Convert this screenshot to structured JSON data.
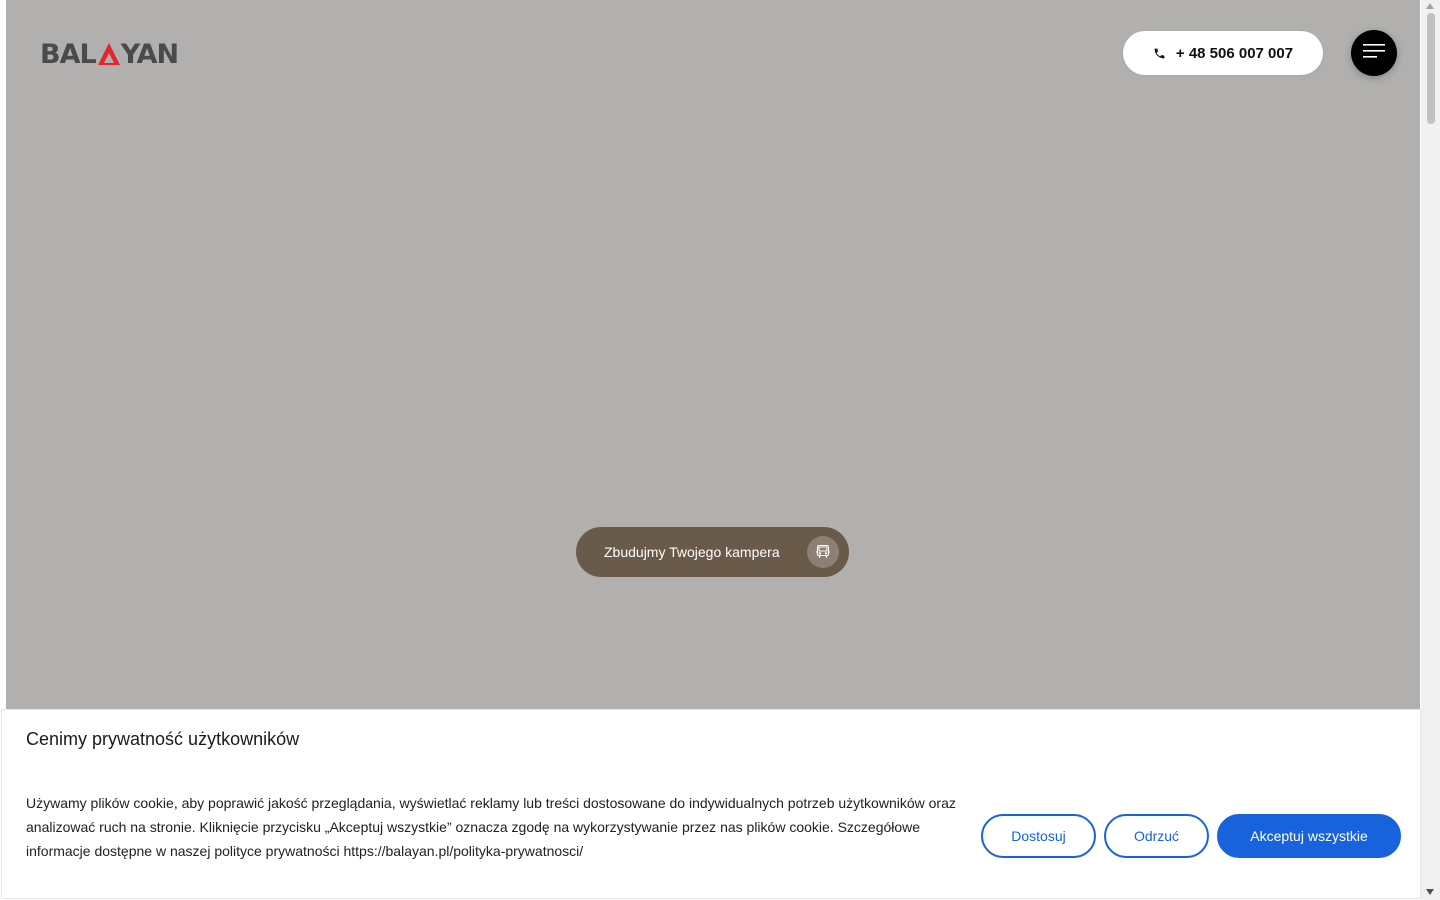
{
  "header": {
    "logo_alt": "BALAYAN",
    "logo_parts": [
      "BAL",
      "YAN"
    ],
    "phone": "+ 48 506 007 007",
    "menu_icon": "hamburger-icon"
  },
  "hero": {
    "cta_label": "Zbudujmy Twojego kampera",
    "cta_icon": "camper-van-icon"
  },
  "cookie_banner": {
    "title": "Cenimy prywatność użytkowników",
    "text": "Używamy plików cookie, aby poprawić jakość przeglądania, wyświetlać reklamy lub treści dostosowane do indywidualnych potrzeb użytkowników oraz analizować ruch na stronie. Kliknięcie przycisku „Akceptuj wszystkie” oznacza zgodę na wykorzystywanie przez nas plików cookie. Szczegółowe informacje dostępne w naszej polityce prywatności https://balayan.pl/polityka-prywatnosci/",
    "customize_label": "Dostosuj",
    "reject_label": "Odrzuć",
    "accept_label": "Akceptuj wszystkie"
  },
  "colors": {
    "hero_bg": "#b1b0ae",
    "cta_bg": "#6a5a49",
    "accent_blue": "#1863dc",
    "logo_red": "#e3262d",
    "logo_gray": "#4a4a4a"
  }
}
